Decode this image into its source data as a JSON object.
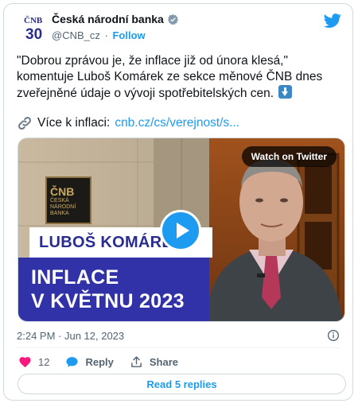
{
  "account": {
    "display_name": "Česká národní banka",
    "handle": "@CNB_cz",
    "separator": "·",
    "follow_label": "Follow",
    "avatar_text_top": "ČNB",
    "avatar_text_num": "30"
  },
  "tweet": {
    "text": "\"Dobrou zprávou je, že inflace již od února klesá,\" komentuje Luboš Komárek ze sekce měnové ČNB dnes zveřejněné údaje o vývoji spotřebitelských cen.",
    "link_prefix": "Více k inflaci:",
    "link_url": "cnb.cz/cs/verejnost/s..."
  },
  "media": {
    "watch_label": "Watch on Twitter",
    "name_banner": "LUBOŠ KOMÁREK",
    "title_line1": "INFLACE",
    "title_line2": "V KVĚTNU 2023",
    "sign_top": "ČNB",
    "sign_line1": "ČESKÁ",
    "sign_line2": "NÁRODNÍ",
    "sign_line3": "BANKA"
  },
  "meta": {
    "timestamp": "2:24 PM · Jun 12, 2023"
  },
  "actions": {
    "like_count": "12",
    "reply_label": "Reply",
    "share_label": "Share",
    "read_replies_label": "Read 5 replies"
  },
  "colors": {
    "brand_blue": "#1d9bf0",
    "like_pink": "#f91880",
    "banner_navy": "#3232a8"
  }
}
